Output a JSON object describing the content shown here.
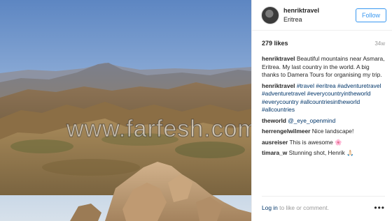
{
  "watermark": {
    "text": "www.farfesh.com"
  },
  "header": {
    "username": "henriktravel",
    "location": "Eritrea",
    "follow_label": "Follow"
  },
  "stats": {
    "likes": "279 likes",
    "time": "34w"
  },
  "comments": [
    {
      "user": "henriktravel",
      "text": "Beautiful mountains near Asmara, Eritrea. My last country in the world. A big thanks to Damera Tours for organising my trip."
    },
    {
      "user": "henriktravel",
      "text": "#travel #eritrea #adventuretravel #adventuretravel #everycountryintheworld #everycountry #allcountriesintheworld #allcountries"
    },
    {
      "user": "theworld",
      "text": "@_eye_openmind"
    },
    {
      "user": "herrengelwilmeer",
      "text": "Nice landscape!"
    },
    {
      "user": "ausreiser",
      "text": "This is awesome 🌸"
    },
    {
      "user": "timara_w",
      "text": "Stunning shot, Henrik 🙏🏻"
    }
  ],
  "footer": {
    "login_label": "Log in",
    "rest_label": " to like or comment.",
    "more_icon": "more-icon"
  },
  "colors": {
    "accent": "#3897f0",
    "hashtag": "#003569",
    "muted": "#999999"
  }
}
